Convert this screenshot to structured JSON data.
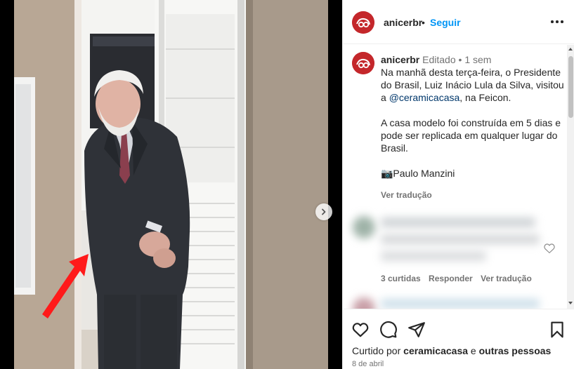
{
  "post": {
    "username": "anicerbr",
    "follow_label": "Seguir",
    "header_separator": "•",
    "more_icon": "more-horizontal-icon"
  },
  "caption": {
    "username": "anicerbr",
    "edited_label": "Editado",
    "separator": "•",
    "time": "1 sem",
    "text_part1": "Na manhã desta terça-feira, o Presidente do Brasil, Luiz Inácio Lula da Silva, visitou a ",
    "mention": "@ceramicacasa",
    "text_part2": ", na Feicon.\n\nA casa modelo foi construída em 5 dias e pode ser replicada em qualquer lugar do Brasil.\n\n📷Paulo Manzini",
    "see_translation": "Ver tradução"
  },
  "comment": {
    "replies": "3 curtidas",
    "reply_label": "Responder",
    "see_translation": "Ver tradução",
    "like_icon": "heart-outline-icon"
  },
  "actions": {
    "like_icon": "heart-icon",
    "comment_icon": "comment-icon",
    "share_icon": "share-icon",
    "save_icon": "bookmark-icon",
    "carousel_next_icon": "chevron-right-icon"
  },
  "likes": {
    "prefix": "Curtido por ",
    "user": "ceramicacasa",
    "middle": " e ",
    "others": "outras pessoas"
  },
  "date": "8 de abril",
  "colors": {
    "brand_red": "#c4272b",
    "link_blue": "#0095f6",
    "mention_blue": "#00376b",
    "muted": "#737373",
    "annotation_arrow": "#ff1a1a"
  }
}
